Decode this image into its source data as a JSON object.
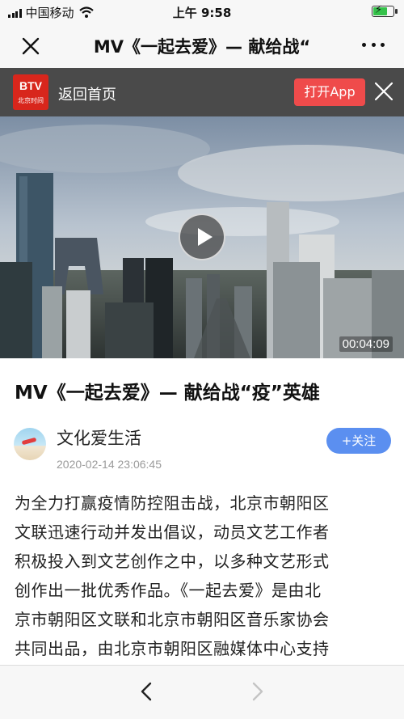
{
  "status_bar": {
    "carrier": "中国移动",
    "time": "上午 9:58",
    "battery_level": 0.75,
    "battery_color": "#35c24a"
  },
  "nav": {
    "title": "MV《一起去爱》— 献给战“"
  },
  "banner": {
    "logo_text": "BTV",
    "logo_subtext": "北京时间",
    "back_home": "返回首页",
    "open_app": "打开App",
    "open_app_color": "#ef4b4b"
  },
  "video": {
    "duration": "00:04:09"
  },
  "article": {
    "title": "MV《一起去爱》— 献给战“疫”英雄",
    "author": "文化爱生活",
    "post_time": "2020-02-14 23:06:45",
    "follow_label": "+关注",
    "follow_color": "#5b8ff0",
    "body_lines": [
      "为全力打赢疫情防控阻击战，北京市朝阳区",
      "文联迅速行动并发出倡议，动员文艺工作者",
      "积极投入到文艺创作之中，以多种文艺形式",
      "创作出一批优秀作品。《一起去爱》是由北",
      "京市朝阳区文联和北京市朝阳区音乐家协会",
      "共同出品，由北京市朝阳区融媒体中心支持"
    ]
  },
  "icons": {
    "close": "close-icon",
    "more": "more-dots-icon",
    "play": "play-icon",
    "back": "chevron-left-icon",
    "forward": "chevron-right-icon"
  }
}
